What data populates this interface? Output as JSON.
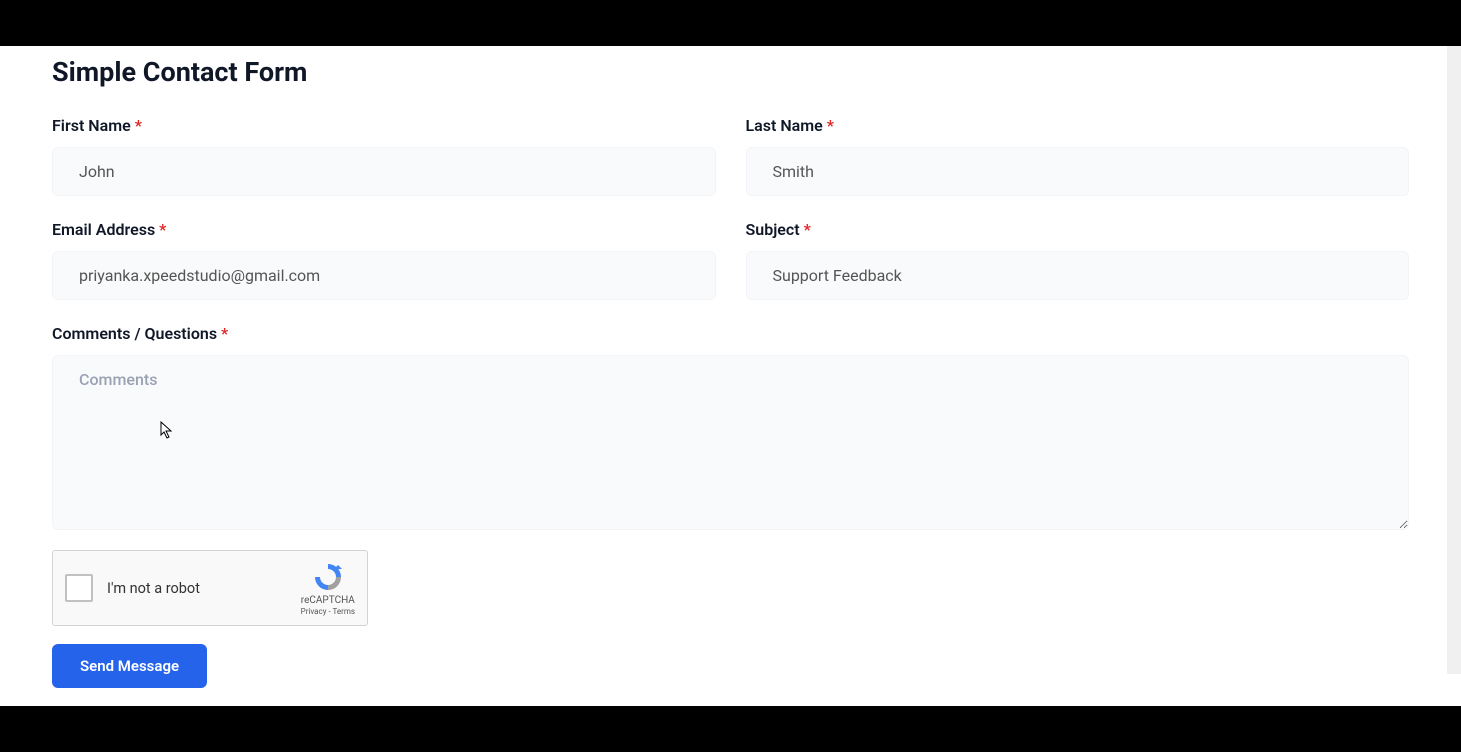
{
  "title": "Simple Contact Form",
  "fields": {
    "firstName": {
      "label": "First Name",
      "value": "John",
      "required": true
    },
    "lastName": {
      "label": "Last Name",
      "value": "Smith",
      "required": true
    },
    "email": {
      "label": "Email Address",
      "value": "priyanka.xpeedstudio@gmail.com",
      "required": true
    },
    "subject": {
      "label": "Subject",
      "value": "Support Feedback",
      "required": true
    },
    "comments": {
      "label": "Comments / Questions",
      "placeholder": "Comments",
      "value": "",
      "required": true
    }
  },
  "recaptcha": {
    "label": "I'm not a robot",
    "brandName": "reCAPTCHA",
    "privacyLabel": "Privacy",
    "termsLabel": "Terms"
  },
  "submit": {
    "label": "Send Message"
  },
  "requiredMark": "*"
}
